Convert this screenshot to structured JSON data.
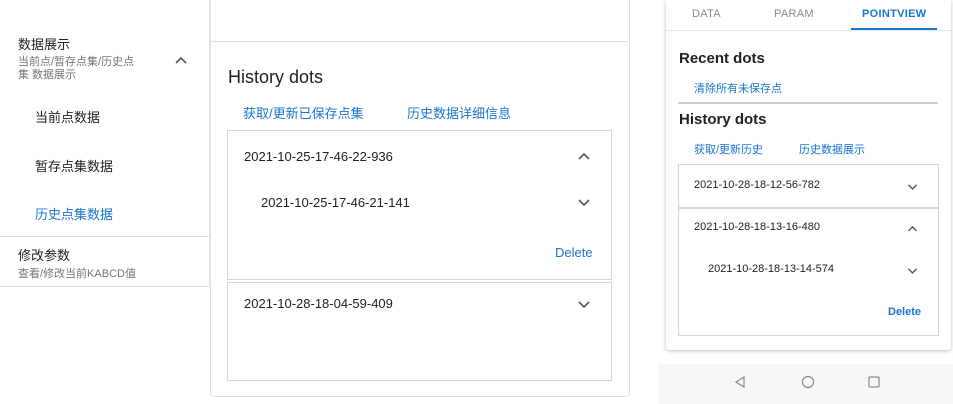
{
  "sidebar": {
    "section1_title": "数据展示",
    "section1_sub_line1": "当前点/暂存点集/历史点",
    "section1_sub_line2": "集 数据展示",
    "items": [
      {
        "label": "当前点数据"
      },
      {
        "label": "暂存点集数据"
      },
      {
        "label": "历史点集数据"
      }
    ],
    "section2_title": "修改参数",
    "section2_sub": "查看/修改当前KABCD值"
  },
  "main": {
    "title": "History dots",
    "actions": [
      "获取/更新已保存点集",
      "历史数据详细信息"
    ],
    "groups": [
      {
        "name": "2021-10-25-17-46-22-936",
        "child": "2021-10-25-17-46-21-141",
        "delete_label": "Delete"
      },
      {
        "name": "2021-10-28-18-04-59-409"
      }
    ]
  },
  "phone": {
    "tabs": [
      "DATA",
      "PARAM",
      "POINTVIEW"
    ],
    "recent_title": "Recent dots",
    "clear_unsaved": "清除所有未保存点",
    "history_title": "History dots",
    "actions": [
      "获取/更新历史",
      "历史数据展示"
    ],
    "groups": [
      {
        "name": "2021-10-28-18-12-56-782"
      },
      {
        "name": "2021-10-28-18-13-16-480",
        "child": "2021-10-28-18-13-14-574",
        "delete_label": "Delete"
      }
    ]
  },
  "colors": {
    "accent": "#1976d2",
    "text": "#212121",
    "muted": "#757575",
    "border": "#e0e0e0"
  }
}
